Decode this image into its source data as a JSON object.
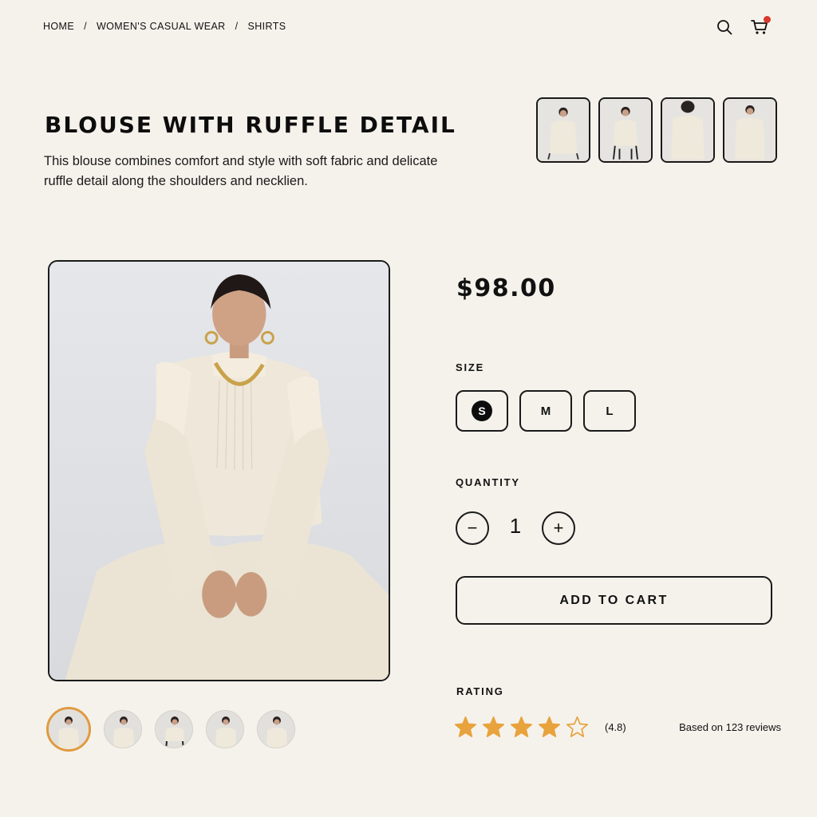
{
  "breadcrumb": {
    "items": [
      "HOME",
      "WOMEN'S CASUAL WEAR",
      "SHIRTS"
    ],
    "separator": "/"
  },
  "header_icons": [
    "search-icon",
    "cart-icon"
  ],
  "product": {
    "title": "BLOUSE WITH RUFFLE DETAIL",
    "description": "This blouse combines comfort and style with soft fabric and delicate ruffle detail along the shoulders and necklien.",
    "price": "$98.00"
  },
  "size": {
    "label": "SIZE",
    "options": [
      "S",
      "M",
      "L"
    ],
    "selected": "S"
  },
  "quantity": {
    "label": "QUANTITY",
    "value": "1",
    "decrement": "−",
    "increment": "+"
  },
  "cta": {
    "add_to_cart": "ADD TO CART"
  },
  "rating": {
    "label": "RATING",
    "stars_filled": 4,
    "stars_total": 5,
    "value_text": "(4.8)",
    "reviews_text": "Based on 123 reviews"
  },
  "colors": {
    "background": "#f5f2ec",
    "accent_star": "#e8a33d",
    "cart_badge": "#d9382c",
    "active_thumb_ring": "#e09a3f"
  }
}
